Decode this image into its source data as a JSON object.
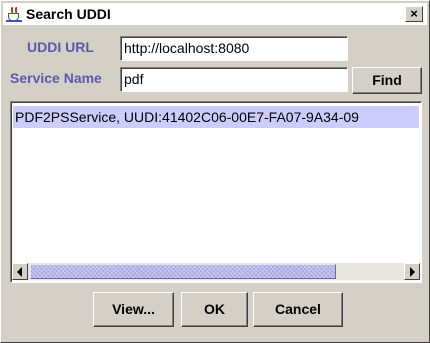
{
  "window": {
    "title": "Search UDDI",
    "close_label": "×",
    "icon": "java-cup-icon"
  },
  "form": {
    "uddi_url_label": "UDDI URL",
    "uddi_url_value": "http://localhost:8080",
    "service_name_label": "Service Name",
    "service_name_value": "pdf",
    "find_label": "Find"
  },
  "results": {
    "items": [
      {
        "text": "PDF2PSService, UUDI:41402C06-00E7-FA07-9A34-09",
        "selected": true
      }
    ]
  },
  "scrollbar": {
    "left_icon": "scroll-left-arrow-icon",
    "right_icon": "scroll-right-arrow-icon",
    "thumb_color": "#b8b8e8"
  },
  "buttons": {
    "view_label": "View...",
    "ok_label": "OK",
    "cancel_label": "Cancel"
  },
  "colors": {
    "dialog_bg": "#d4d0c8",
    "label_color": "#5a5aa8",
    "selection_bg": "#ccccff"
  }
}
